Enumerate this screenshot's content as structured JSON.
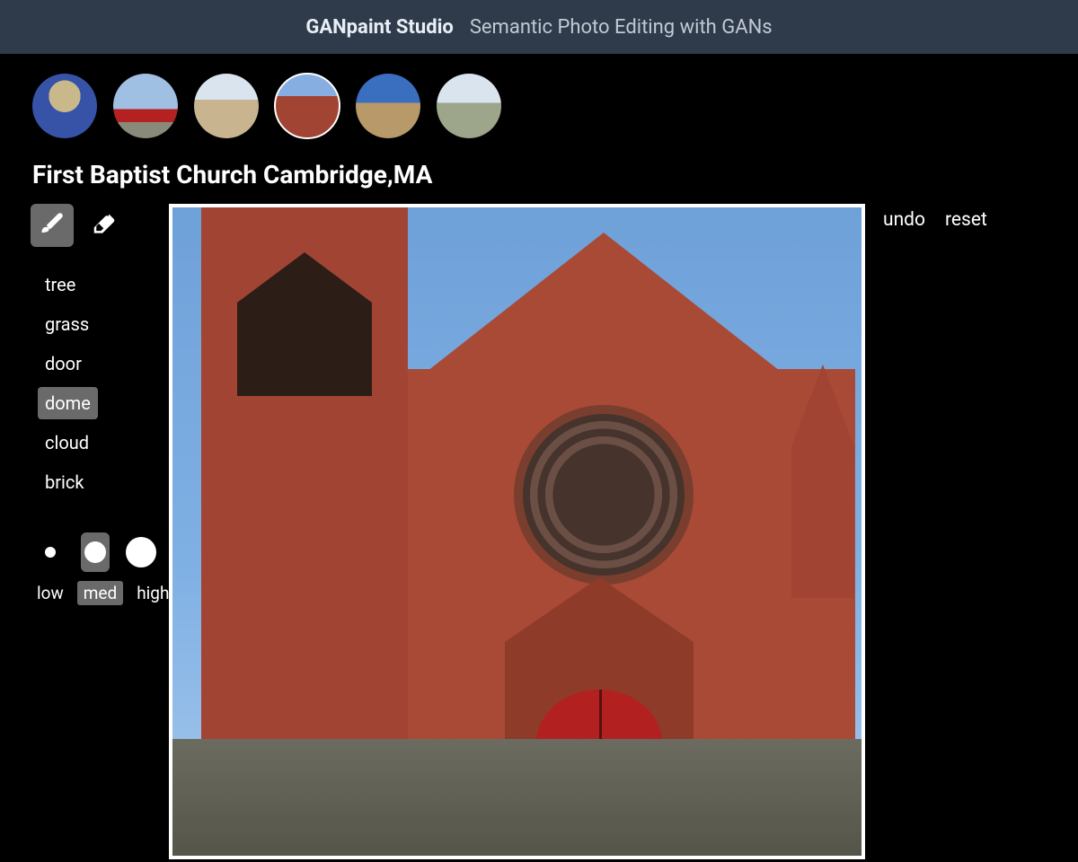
{
  "header": {
    "title": "GANpaint Studio",
    "subtitle": "Semantic Photo Editing with GANs"
  },
  "thumbnails": {
    "count": 6,
    "selected_index": 3,
    "items": [
      {
        "name": "building-thumb-1"
      },
      {
        "name": "building-thumb-2"
      },
      {
        "name": "building-thumb-3"
      },
      {
        "name": "building-thumb-4"
      },
      {
        "name": "building-thumb-5"
      },
      {
        "name": "building-thumb-6"
      }
    ]
  },
  "image_title": "First Baptist Church Cambridge,MA",
  "tools": {
    "brush_label": "brush",
    "eraser_label": "eraser",
    "active": "brush"
  },
  "semantics": {
    "items": [
      "tree",
      "grass",
      "door",
      "dome",
      "cloud",
      "brick"
    ],
    "selected": "dome"
  },
  "brush_size": {
    "labels": {
      "low": "low",
      "med": "med",
      "high": "high"
    },
    "selected": "med"
  },
  "actions": {
    "undo": "undo",
    "reset": "reset"
  }
}
